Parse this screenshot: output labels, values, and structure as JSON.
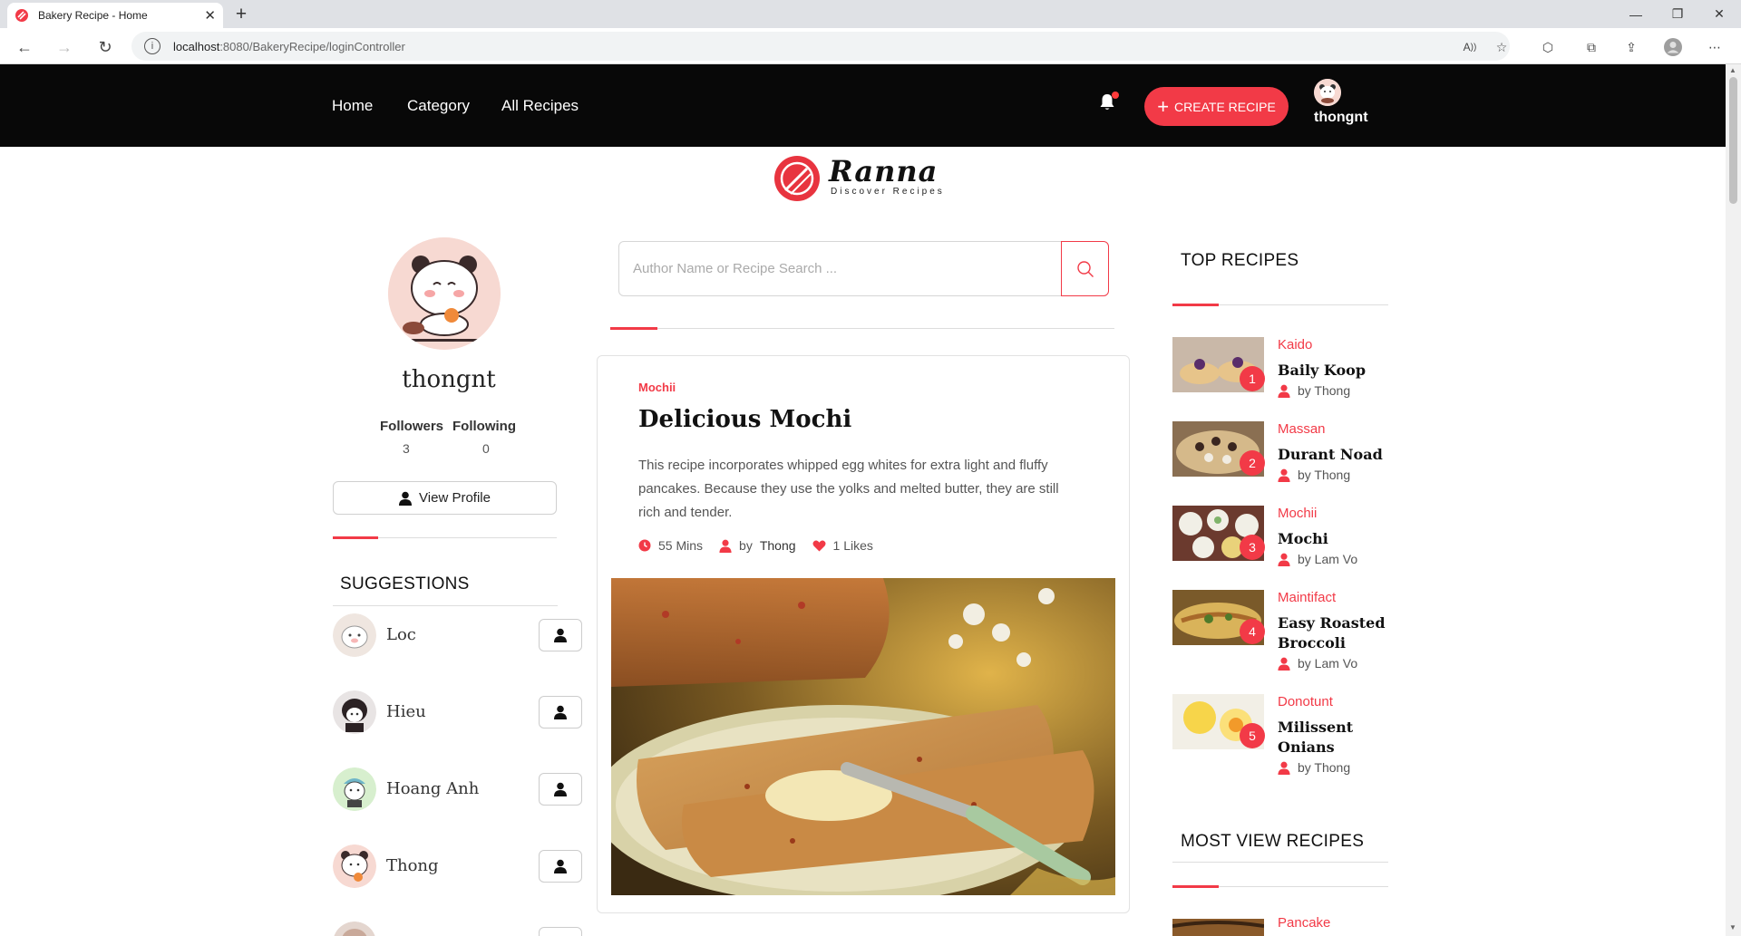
{
  "browser": {
    "tab_title": "Bakery Recipe - Home",
    "url_host": "localhost",
    "url_rest": ":8080/BakeryRecipe/loginController"
  },
  "header": {
    "nav": [
      "Home",
      "Category",
      "All Recipes"
    ],
    "create_label": "CREATE RECIPE",
    "username": "thongnt"
  },
  "logo": {
    "word": "Ranna",
    "tagline": "Discover Recipes"
  },
  "profile": {
    "name": "thongnt",
    "followers_label": "Followers",
    "followers": "3",
    "following_label": "Following",
    "following": "0",
    "view_profile": "View Profile"
  },
  "suggestions": {
    "title": "SUGGESTIONS",
    "items": [
      {
        "name": "Loc"
      },
      {
        "name": "Hieu"
      },
      {
        "name": "Hoang Anh"
      },
      {
        "name": "Thong"
      }
    ]
  },
  "search": {
    "placeholder": "Author Name or Recipe Search ..."
  },
  "featured": {
    "category": "Mochii",
    "title": "Delicious Mochi",
    "description": "This recipe incorporates whipped egg whites for extra light and fluffy pancakes. Because they use the yolks and melted butter, they are still rich and tender.",
    "time": "55 Mins",
    "by": "by",
    "author": "Thong",
    "likes": "1 Likes"
  },
  "top_recipes": {
    "title": "TOP RECIPES",
    "items": [
      {
        "rank": "1",
        "category": "Kaido",
        "name": "Baily Koop",
        "by": "by Thong"
      },
      {
        "rank": "2",
        "category": "Massan",
        "name": "Durant Noad",
        "by": "by Thong"
      },
      {
        "rank": "3",
        "category": "Mochii",
        "name": "Mochi",
        "by": "by Lam Vo"
      },
      {
        "rank": "4",
        "category": "Maintifact",
        "name": "Easy Roasted Broccoli",
        "by": "by Lam Vo"
      },
      {
        "rank": "5",
        "category": "Donotunt",
        "name": "Milissent Onians",
        "by": "by Thong"
      }
    ]
  },
  "most_view": {
    "title": "MOST VIEW RECIPES",
    "first_category": "Pancake"
  },
  "colors": {
    "accent": "#f23a47",
    "header_bg": "#080808"
  }
}
